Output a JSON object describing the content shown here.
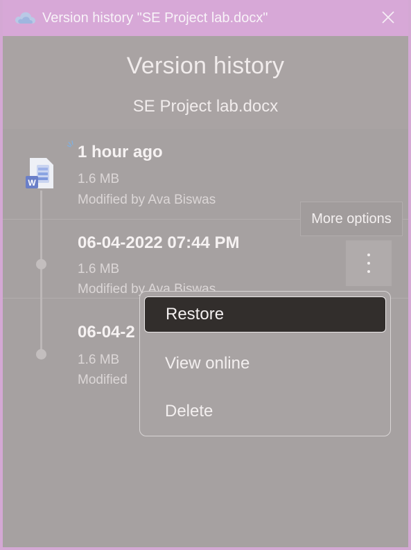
{
  "window": {
    "title": "Version history \"SE Project lab.docx\"",
    "close_icon": "close-icon",
    "app_icon": "onedrive-cloud-icon"
  },
  "header": {
    "title": "Version history",
    "filename": "SE Project lab.docx"
  },
  "versions": [
    {
      "time": "1 hour ago",
      "size": "1.6 MB",
      "modified_by": "Modified by Ava Biswas"
    },
    {
      "time": "06-04-2022 07:44 PM",
      "size": "1.6 MB",
      "modified_by": "Modified by Ava Biswas"
    },
    {
      "time": "06-04-2",
      "size": "1.6 MB",
      "modified_by": "Modified"
    }
  ],
  "tooltip": {
    "text": "More options"
  },
  "context_menu": {
    "items": [
      {
        "label": "Restore",
        "active": true
      },
      {
        "label": "View online",
        "active": false
      },
      {
        "label": "Delete",
        "active": false
      }
    ]
  },
  "colors": {
    "titlebar": "#d7a8d7",
    "overlay": "#a8a3a3",
    "menu_active": "#322e2c"
  }
}
